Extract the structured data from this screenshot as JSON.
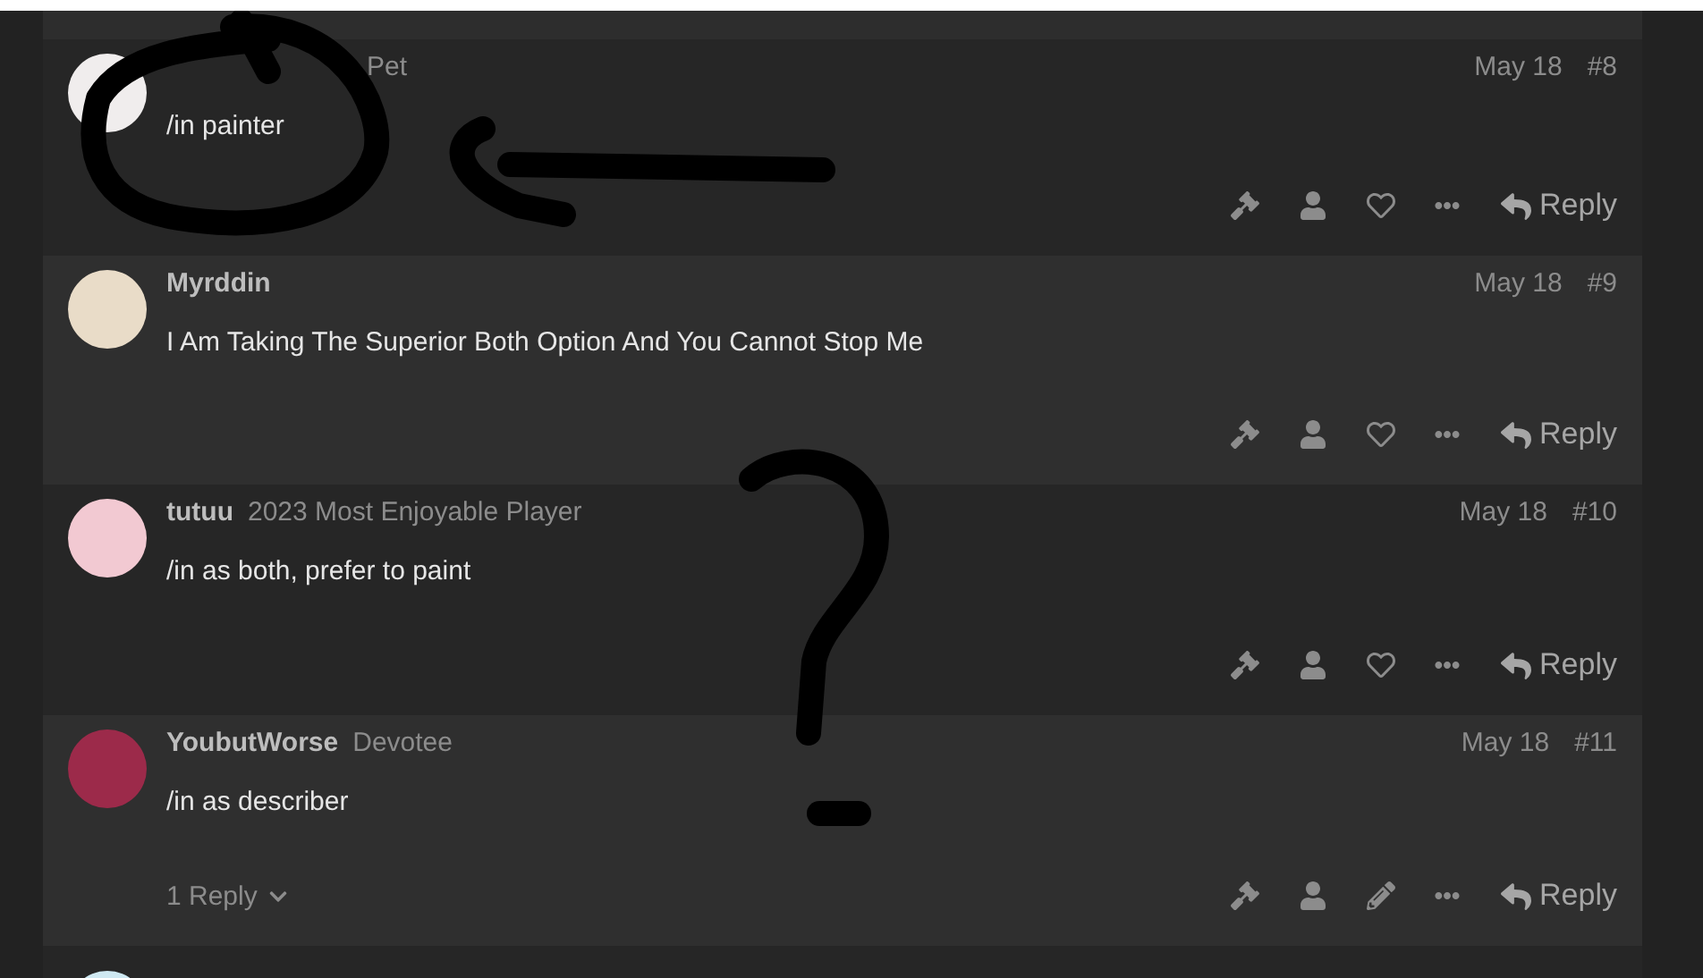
{
  "posts": [
    {
      "user_title": "Pet",
      "date": "May 18",
      "number": "#8",
      "body": "/in painter",
      "actions": [
        {
          "kind": "flag"
        },
        {
          "kind": "user"
        },
        {
          "kind": "like"
        },
        {
          "kind": "more"
        },
        {
          "kind": "reply",
          "label": "Reply"
        }
      ]
    },
    {
      "username": "Myrddin",
      "date": "May 18",
      "number": "#9",
      "body": "I Am Taking The Superior Both Option And You Cannot Stop Me",
      "actions": [
        {
          "kind": "flag"
        },
        {
          "kind": "user"
        },
        {
          "kind": "like"
        },
        {
          "kind": "more"
        },
        {
          "kind": "reply",
          "label": "Reply"
        }
      ]
    },
    {
      "username": "tutuu",
      "user_title": "2023 Most Enjoyable Player",
      "date": "May 18",
      "number": "#10",
      "body": "/in as both, prefer to paint",
      "actions": [
        {
          "kind": "flag"
        },
        {
          "kind": "user"
        },
        {
          "kind": "like"
        },
        {
          "kind": "more"
        },
        {
          "kind": "reply",
          "label": "Reply"
        }
      ]
    },
    {
      "username": "YoubutWorse",
      "user_title": "Devotee",
      "date": "May 18",
      "number": "#11",
      "body": "/in as describer",
      "replies": "1 Reply",
      "actions": [
        {
          "kind": "flag"
        },
        {
          "kind": "user"
        },
        {
          "kind": "edit"
        },
        {
          "kind": "more"
        },
        {
          "kind": "reply",
          "label": "Reply"
        }
      ]
    }
  ]
}
